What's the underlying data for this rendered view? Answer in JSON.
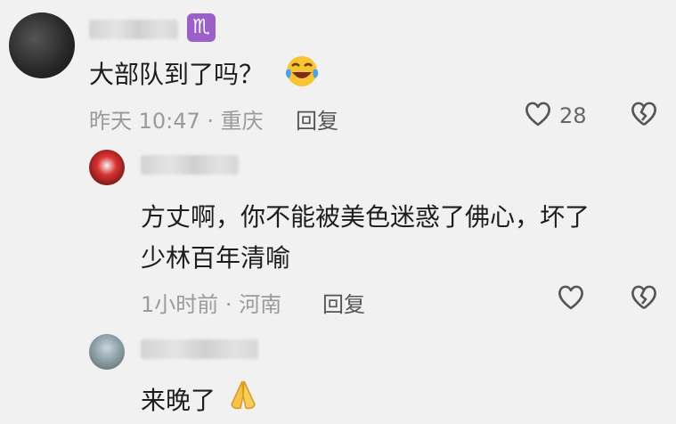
{
  "comments": [
    {
      "zodiac_icon": "scorpio-icon",
      "zodiac_glyph": "♏",
      "text": "大部队到了吗？",
      "emoji": "laughing-crying-emoji",
      "meta": "昨天 10:47 · 重庆",
      "reply_label": "回复",
      "likes": "28"
    },
    {
      "text_line1": "方丈啊，你不能被美色迷惑了佛心，坏了",
      "text_line2": "少林百年清喻",
      "meta": "1小时前 · 河南",
      "reply_label": "回复"
    },
    {
      "text": "来晚了",
      "emoji": "praying-hands-emoji"
    }
  ],
  "colors": {
    "background": "#f1f1f1",
    "badge": "#9b5fc9",
    "meta": "#9a9a9a"
  }
}
